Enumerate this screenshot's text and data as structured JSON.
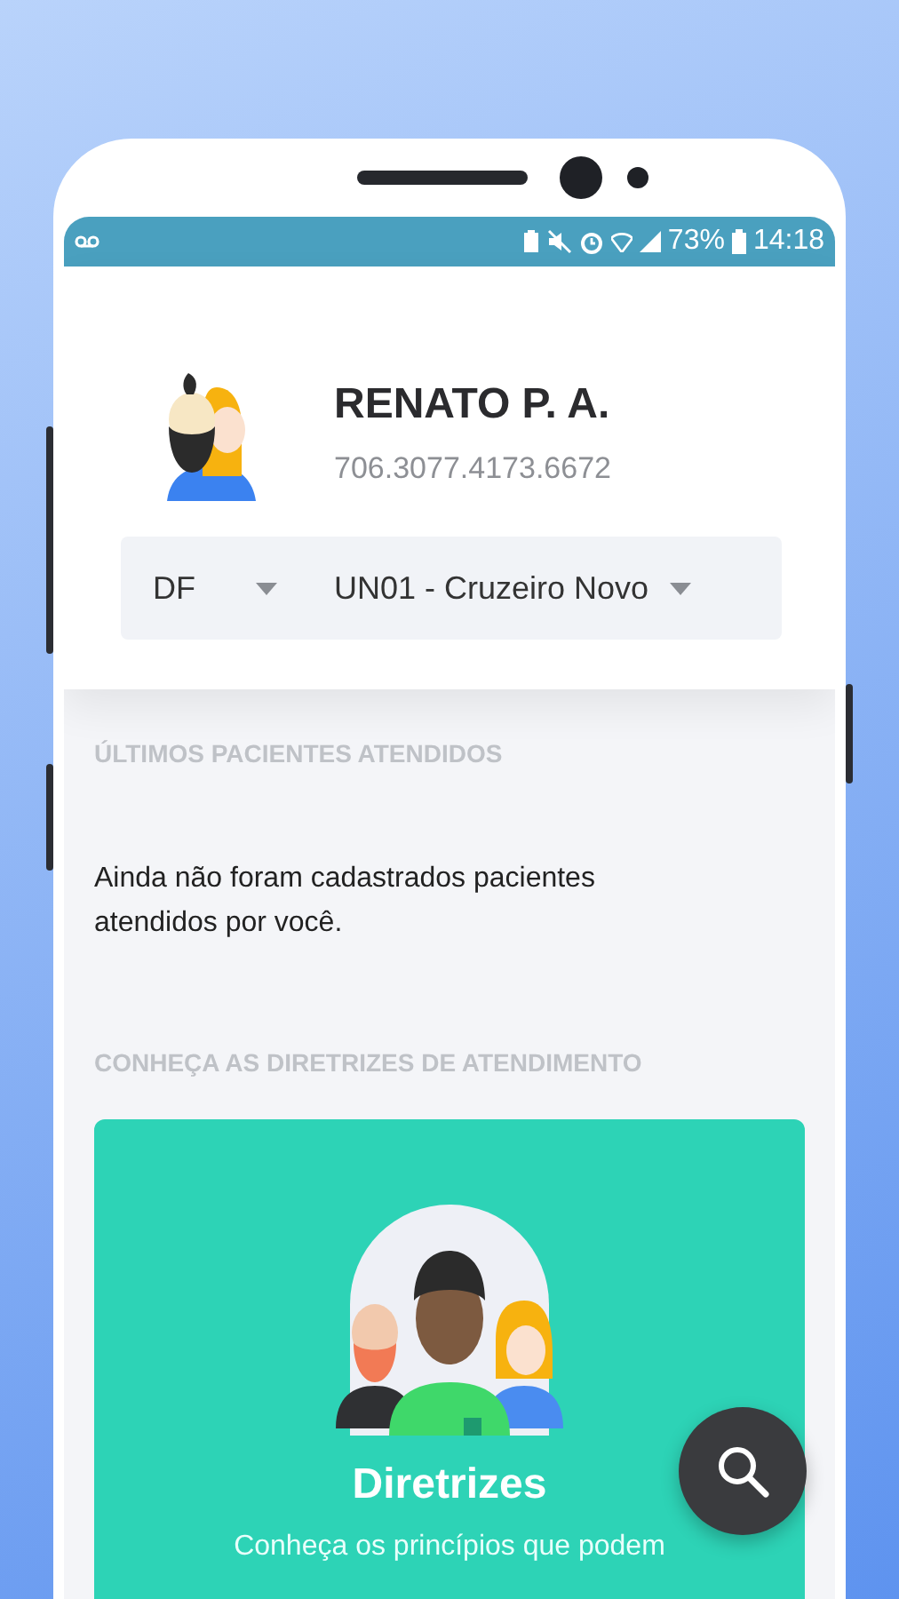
{
  "status_bar": {
    "battery": "73%",
    "time": "14:18"
  },
  "profile": {
    "name": "RENATO P. A.",
    "id": "706.3077.4173.6672"
  },
  "selectors": [
    {
      "value": "DF"
    },
    {
      "value": "UN01 - Cruzeiro Novo"
    }
  ],
  "sections": [
    {
      "heading": "ÚLTIMOS PACIENTES ATENDIDOS",
      "body": "Ainda não foram cadastrados pacientes atendidos por você."
    },
    {
      "heading": "CONHEÇA AS DIRETRIZES DE ATENDIMENTO"
    }
  ],
  "card": {
    "title": "Diretrizes",
    "text": "Conheça os princípios que podem"
  }
}
